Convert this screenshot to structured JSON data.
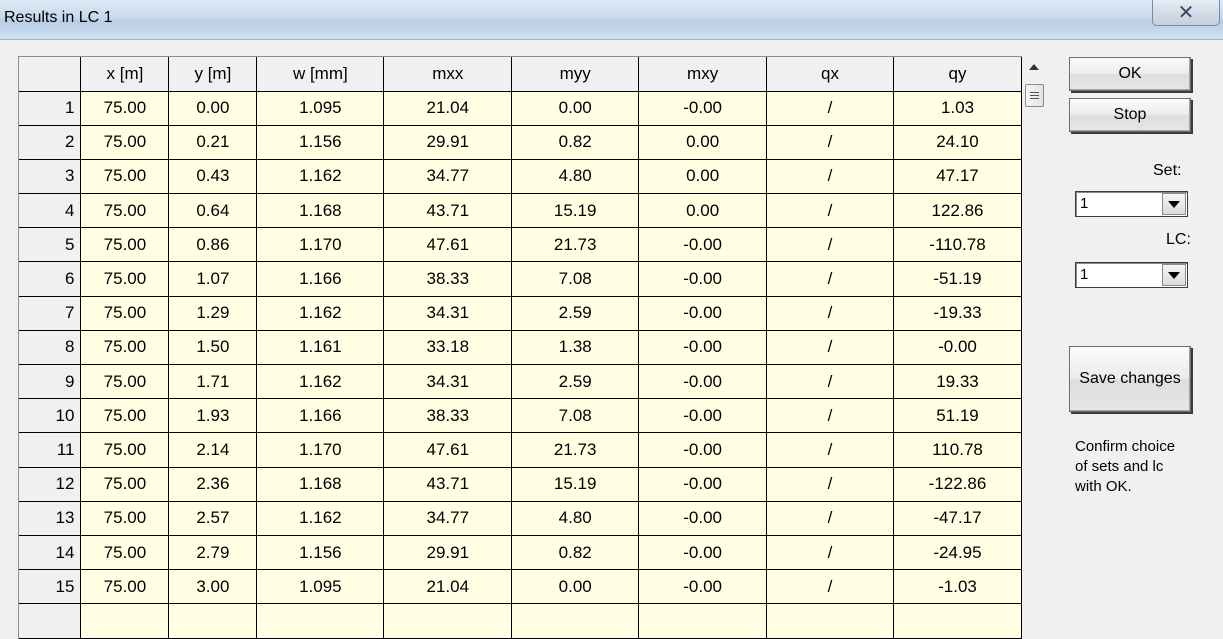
{
  "window": {
    "title": "Results in LC 1",
    "close_symbol": "✕"
  },
  "table": {
    "columns": [
      "x [m]",
      "y [m]",
      "w [mm]",
      "mxx",
      "myy",
      "mxy",
      "qx",
      "qy"
    ],
    "rows": [
      {
        "n": "1",
        "v": [
          "75.00",
          "0.00",
          "1.095",
          "21.04",
          "0.00",
          "-0.00",
          "/",
          "1.03"
        ]
      },
      {
        "n": "2",
        "v": [
          "75.00",
          "0.21",
          "1.156",
          "29.91",
          "0.82",
          "0.00",
          "/",
          "24.10"
        ]
      },
      {
        "n": "3",
        "v": [
          "75.00",
          "0.43",
          "1.162",
          "34.77",
          "4.80",
          "0.00",
          "/",
          "47.17"
        ]
      },
      {
        "n": "4",
        "v": [
          "75.00",
          "0.64",
          "1.168",
          "43.71",
          "15.19",
          "0.00",
          "/",
          "122.86"
        ]
      },
      {
        "n": "5",
        "v": [
          "75.00",
          "0.86",
          "1.170",
          "47.61",
          "21.73",
          "-0.00",
          "/",
          "-110.78"
        ]
      },
      {
        "n": "6",
        "v": [
          "75.00",
          "1.07",
          "1.166",
          "38.33",
          "7.08",
          "-0.00",
          "/",
          "-51.19"
        ]
      },
      {
        "n": "7",
        "v": [
          "75.00",
          "1.29",
          "1.162",
          "34.31",
          "2.59",
          "-0.00",
          "/",
          "-19.33"
        ]
      },
      {
        "n": "8",
        "v": [
          "75.00",
          "1.50",
          "1.161",
          "33.18",
          "1.38",
          "-0.00",
          "/",
          "-0.00"
        ]
      },
      {
        "n": "9",
        "v": [
          "75.00",
          "1.71",
          "1.162",
          "34.31",
          "2.59",
          "-0.00",
          "/",
          "19.33"
        ]
      },
      {
        "n": "10",
        "v": [
          "75.00",
          "1.93",
          "1.166",
          "38.33",
          "7.08",
          "-0.00",
          "/",
          "51.19"
        ]
      },
      {
        "n": "11",
        "v": [
          "75.00",
          "2.14",
          "1.170",
          "47.61",
          "21.73",
          "-0.00",
          "/",
          "110.78"
        ]
      },
      {
        "n": "12",
        "v": [
          "75.00",
          "2.36",
          "1.168",
          "43.71",
          "15.19",
          "-0.00",
          "/",
          "-122.86"
        ]
      },
      {
        "n": "13",
        "v": [
          "75.00",
          "2.57",
          "1.162",
          "34.77",
          "4.80",
          "-0.00",
          "/",
          "-47.17"
        ]
      },
      {
        "n": "14",
        "v": [
          "75.00",
          "2.79",
          "1.156",
          "29.91",
          "0.82",
          "-0.00",
          "/",
          "-24.95"
        ]
      },
      {
        "n": "15",
        "v": [
          "75.00",
          "3.00",
          "1.095",
          "21.04",
          "0.00",
          "-0.00",
          "/",
          "-1.03"
        ]
      }
    ]
  },
  "buttons": {
    "ok": "OK",
    "stop": "Stop",
    "save": "Save changes"
  },
  "set": {
    "label": "Set:",
    "value": "1"
  },
  "lc": {
    "label": "LC:",
    "value": "1"
  },
  "note": "Confirm choice of sets and lc with OK.",
  "colors": {
    "cell_background": "#ffffe4",
    "window_background": "#f0f0f0"
  }
}
